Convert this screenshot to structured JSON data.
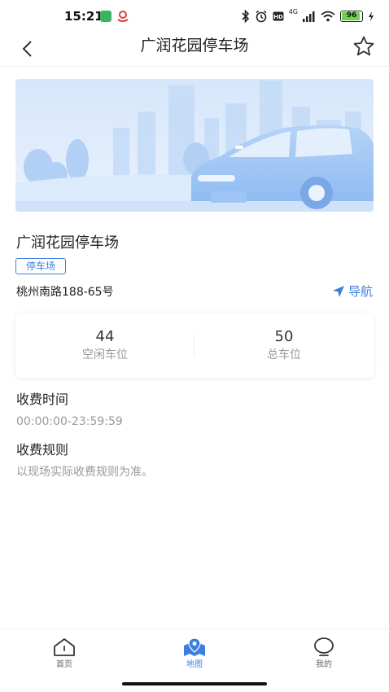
{
  "status_bar": {
    "time": "15:21",
    "network": "4G",
    "battery": "96"
  },
  "nav": {
    "title": "广润花园停车场"
  },
  "lot": {
    "name": "广润花园停车场",
    "tag": "停车场",
    "address": "桃州南路188-65号",
    "navigate_label": "导航"
  },
  "stats": {
    "free_value": "44",
    "free_label": "空闲车位",
    "total_value": "50",
    "total_label": "总车位"
  },
  "fee_time": {
    "title": "收费时间",
    "value": "00:00:00-23:59:59"
  },
  "fee_rules": {
    "title": "收费规则",
    "value": "以现场实际收费规则为准。"
  },
  "tabs": [
    {
      "label": "首页",
      "icon": "home-icon",
      "active": false
    },
    {
      "label": "地图",
      "icon": "map-icon",
      "active": true
    },
    {
      "label": "我的",
      "icon": "profile-icon",
      "active": false
    }
  ],
  "colors": {
    "accent": "#3d7fe0",
    "muted_text": "#999999",
    "banner_bg": "#dbe9fb"
  }
}
